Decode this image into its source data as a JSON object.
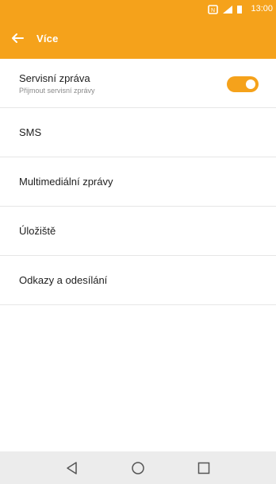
{
  "status_bar": {
    "time": "13:00",
    "icons": [
      "nfc-icon",
      "signal-icon",
      "battery-icon"
    ]
  },
  "app_bar": {
    "title": "Více",
    "back_icon": "arrow-left-icon",
    "color": "#f5a21b"
  },
  "settings": {
    "items": [
      {
        "title": "Servisní zpráva",
        "subtitle": "Přijmout servisní zprávy",
        "toggle_on": true
      },
      {
        "title": "SMS"
      },
      {
        "title": "Multimediální zprávy"
      },
      {
        "title": "Úložiště"
      },
      {
        "title": "Odkazy a odesílání"
      }
    ]
  },
  "nav_bar": {
    "buttons": [
      "back-icon",
      "home-icon",
      "recents-icon"
    ]
  }
}
